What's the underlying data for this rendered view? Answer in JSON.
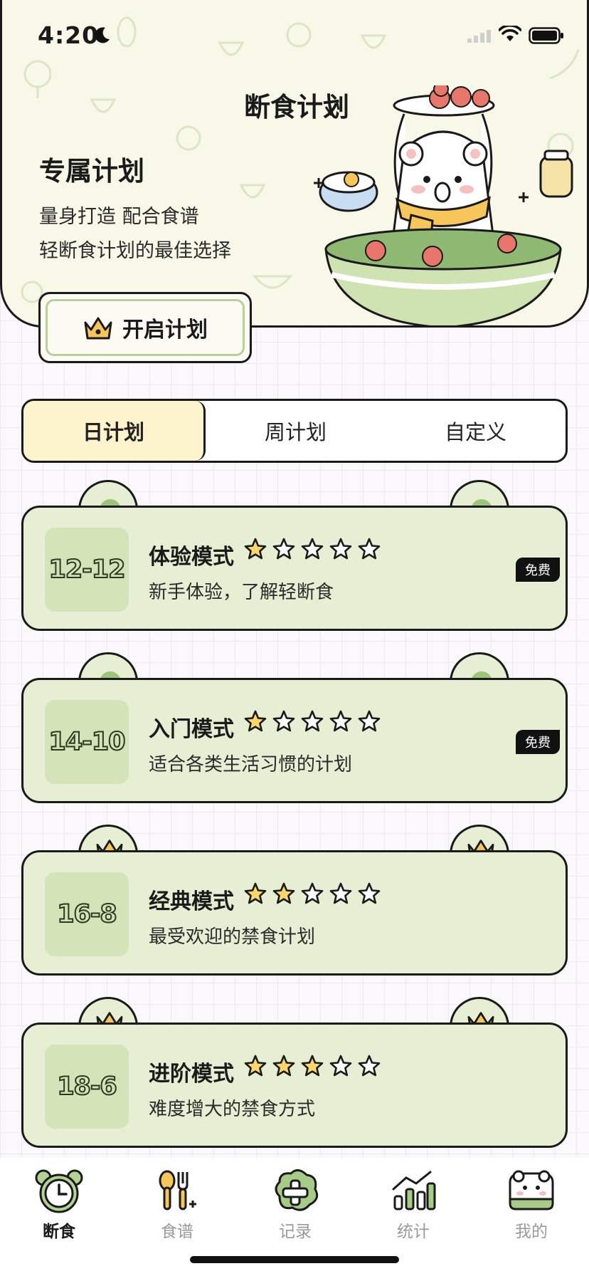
{
  "status_bar": {
    "time": "4:20"
  },
  "header": {
    "title": "断食计划",
    "headline": "专属计划",
    "desc_line1": "量身打造 配合食谱",
    "desc_line2": "轻断食计划的最佳选择",
    "start_button": "开启计划"
  },
  "tabs": [
    {
      "label": "日计划",
      "active": true
    },
    {
      "label": "周计划",
      "active": false
    },
    {
      "label": "自定义",
      "active": false
    }
  ],
  "plans": [
    {
      "ratio": "12-12",
      "title": "体验模式",
      "subtitle": "新手体验，了解轻断食",
      "difficulty": 1,
      "badge": "免费",
      "premium": false
    },
    {
      "ratio": "14-10",
      "title": "入门模式",
      "subtitle": "适合各类生活习惯的计划",
      "difficulty": 1,
      "badge": "免费",
      "premium": false
    },
    {
      "ratio": "16-8",
      "title": "经典模式",
      "subtitle": "最受欢迎的禁食计划",
      "difficulty": 2,
      "badge": "",
      "premium": true
    },
    {
      "ratio": "18-6",
      "title": "进阶模式",
      "subtitle": "难度增大的禁食方式",
      "difficulty": 3,
      "badge": "",
      "premium": true
    }
  ],
  "bottom_nav": [
    {
      "label": "断食",
      "icon": "alarm-clock-icon",
      "active": true
    },
    {
      "label": "食谱",
      "icon": "spoon-fork-icon",
      "active": false
    },
    {
      "label": "记录",
      "icon": "add-record-icon",
      "active": false
    },
    {
      "label": "统计",
      "icon": "bar-chart-icon",
      "active": false
    },
    {
      "label": "我的",
      "icon": "bear-avatar-icon",
      "active": false
    }
  ],
  "colors": {
    "card_bg": "#e6efd3",
    "ratio_bg": "#d4e4b8",
    "active_tab": "#fdf3cc",
    "star_fill": "#fbd66a",
    "accent_green": "#9cc57a"
  }
}
